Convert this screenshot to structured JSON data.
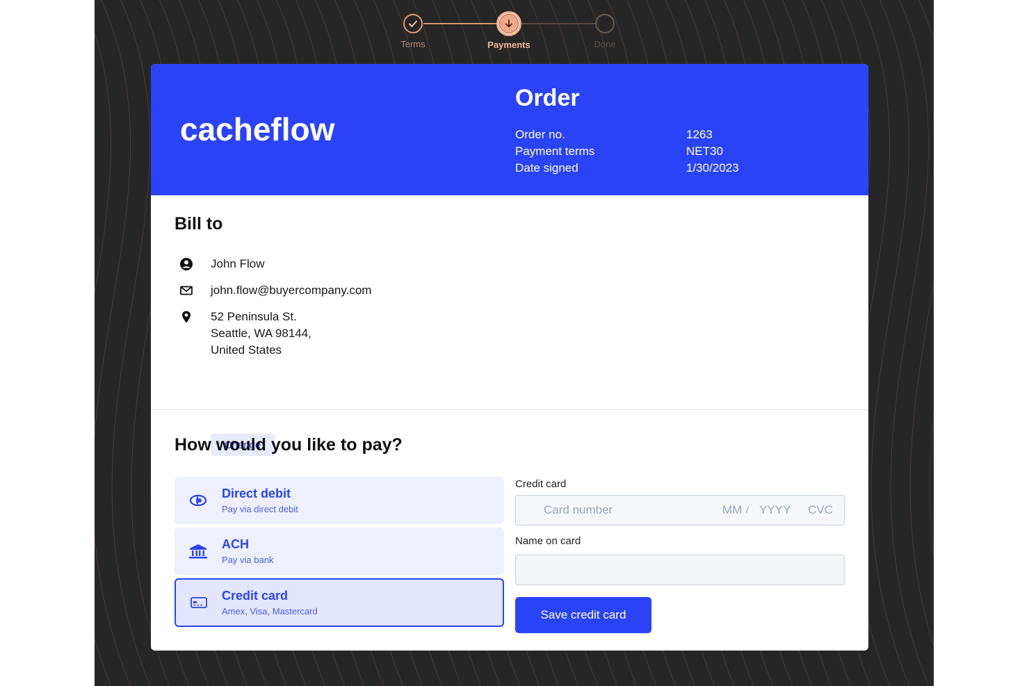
{
  "stepper": {
    "steps": [
      {
        "label": "Terms",
        "state": "done"
      },
      {
        "label": "Payments",
        "state": "active"
      },
      {
        "label": "Done",
        "state": "pending"
      }
    ]
  },
  "header": {
    "logo_text": "cacheflow",
    "title": "Order",
    "rows": [
      {
        "key": "Order no.",
        "value": "1263"
      },
      {
        "key": "Payment terms",
        "value": "NET30"
      },
      {
        "key": "Date signed",
        "value": "1/30/2023"
      }
    ]
  },
  "bill_to": {
    "title": "Bill to",
    "name": "John Flow",
    "email": "john.flow@buyercompany.com",
    "address_line1": "52 Peninsula St.",
    "address_line2": "Seattle, WA 98144,",
    "address_line3": "United States",
    "change_label": "Change"
  },
  "payment": {
    "title": "How would you like to pay?",
    "methods": [
      {
        "name": "Direct debit",
        "sub": "Pay via direct debit",
        "icon": "direct-debit-icon"
      },
      {
        "name": "ACH",
        "sub": "Pay via bank",
        "icon": "bank-icon"
      },
      {
        "name": "Credit card",
        "sub": "Amex, Visa, Mastercard",
        "icon": "credit-card-icon"
      }
    ],
    "selected": "Credit card"
  },
  "credit_card_form": {
    "label": "Credit card",
    "card_number_placeholder": "Card number",
    "mm_placeholder": "MM",
    "separator": "/",
    "yyyy_placeholder": "YYYY",
    "cvc_placeholder": "CVC",
    "name_label": "Name on card",
    "name_value": "",
    "save_label": "Save credit card"
  },
  "colors": {
    "brand": "#2b43f6",
    "step_accent": "#d89a76",
    "background": "#262626"
  }
}
